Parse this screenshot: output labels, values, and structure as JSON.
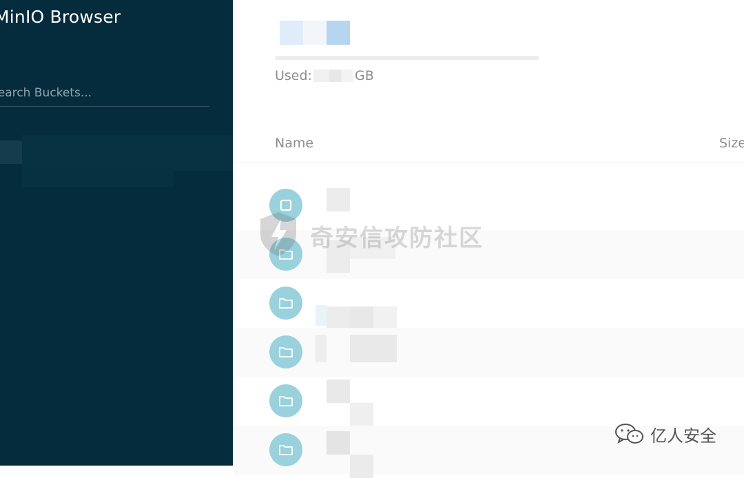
{
  "app": {
    "title": "MinIO Browser"
  },
  "sidebar": {
    "search_placeholder": "Search Buckets..."
  },
  "storage": {
    "used_label": "Used:",
    "used_unit": "GB"
  },
  "table": {
    "columns": [
      "Name",
      "Size"
    ],
    "rows": [
      {
        "icon": "file-icon"
      },
      {
        "icon": "folder-icon"
      },
      {
        "icon": "folder-icon"
      },
      {
        "icon": "folder-icon"
      },
      {
        "icon": "folder-icon"
      },
      {
        "icon": "folder-icon"
      }
    ]
  },
  "watermarks": {
    "center_text": "奇安信攻防社区",
    "corner_text": "亿人安全"
  },
  "colors": {
    "sidebar_bg": "#042c3d",
    "icon_circle": "#99d1dd",
    "text_muted": "#8d8d8d"
  }
}
